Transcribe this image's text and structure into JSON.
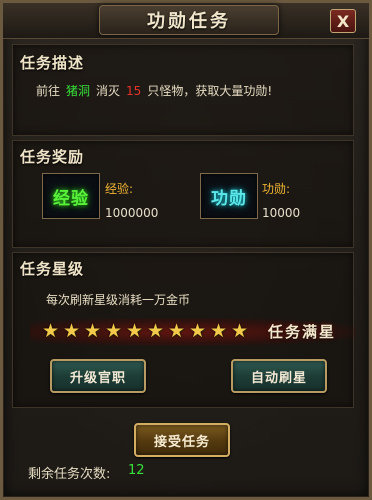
{
  "window": {
    "title": "功勋任务",
    "close_label": "X"
  },
  "description": {
    "heading": "任务描述",
    "prefix": "前往",
    "location": "猪洞",
    "verb": "消灭",
    "count": "15",
    "suffix": "只怪物，获取大量功勋!"
  },
  "reward": {
    "heading": "任务奖励",
    "exp_icon_text": "经验",
    "exp_label": "经验:",
    "exp_value": "1000000",
    "merit_icon_text": "功勋",
    "merit_label": "功勋:",
    "merit_value": "10000"
  },
  "star": {
    "heading": "任务星级",
    "cost_text": "每次刷新星级消耗一万金币",
    "stars_filled": 10,
    "stars_total": 10,
    "full_text": "任务满星",
    "upgrade_button": "升级官职",
    "auto_button": "自动刷星"
  },
  "footer": {
    "accept_button": "接受任务",
    "remaining_label": "剩余任务次数:",
    "remaining_value": "12"
  },
  "colors": {
    "highlight_green": "#36e23a",
    "highlight_red": "#e8312a",
    "label_gold": "#f0b534",
    "star": "#f2c94a"
  },
  "icons": {
    "star": "star-icon",
    "close": "close-icon"
  }
}
